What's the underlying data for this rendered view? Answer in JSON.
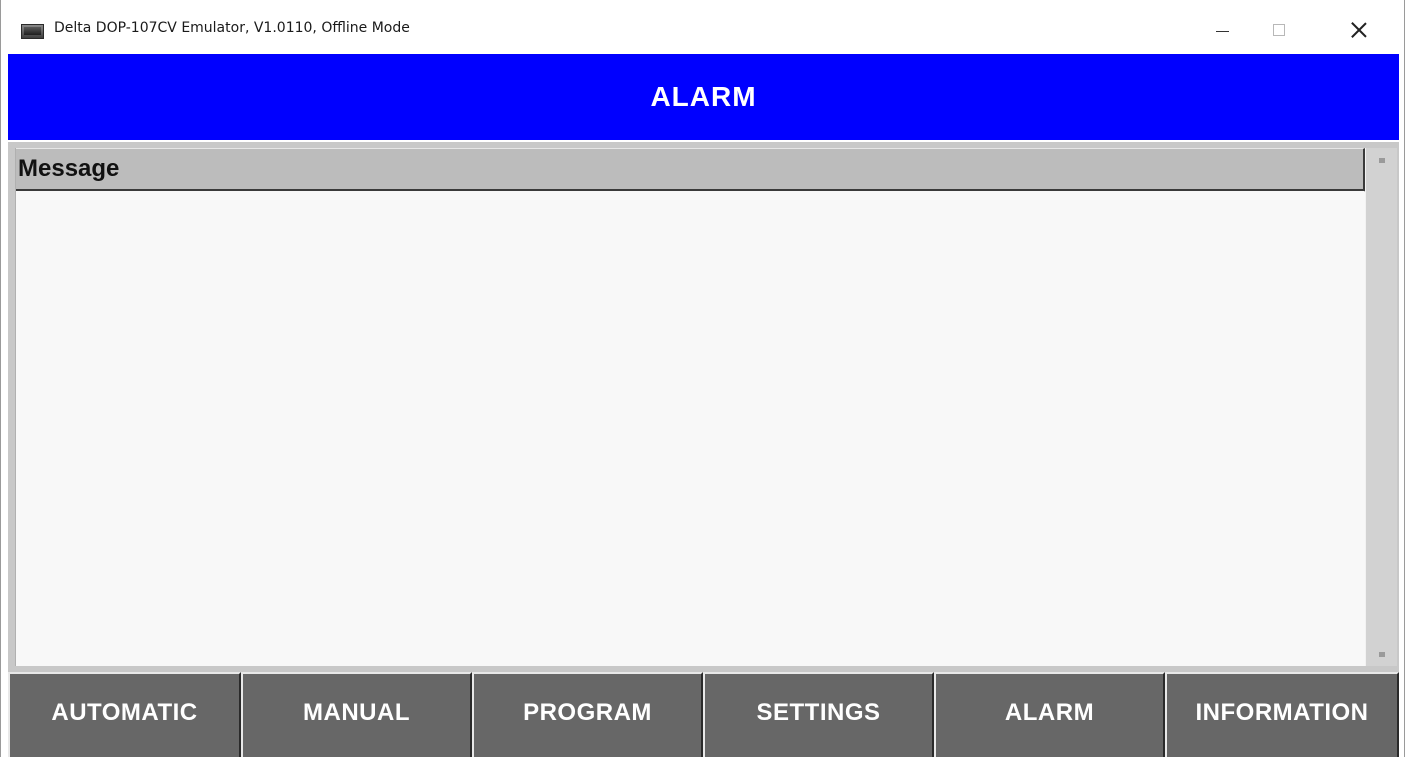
{
  "window": {
    "title": "Delta DOP-107CV Emulator, V1.0110, Offline Mode",
    "controls": {
      "minimize": "minimize",
      "maximize": "maximize",
      "close": "close"
    }
  },
  "header": {
    "title": "ALARM",
    "background_color": "#0000ff",
    "text_color": "#ffffff"
  },
  "alarm_list": {
    "column_header": "Message",
    "rows": []
  },
  "nav": {
    "items": [
      {
        "label": "AUTOMATIC"
      },
      {
        "label": "MANUAL"
      },
      {
        "label": "PROGRAM"
      },
      {
        "label": "SETTINGS"
      },
      {
        "label": "ALARM"
      },
      {
        "label": "INFORMATION"
      }
    ],
    "button_color": "#676767"
  }
}
